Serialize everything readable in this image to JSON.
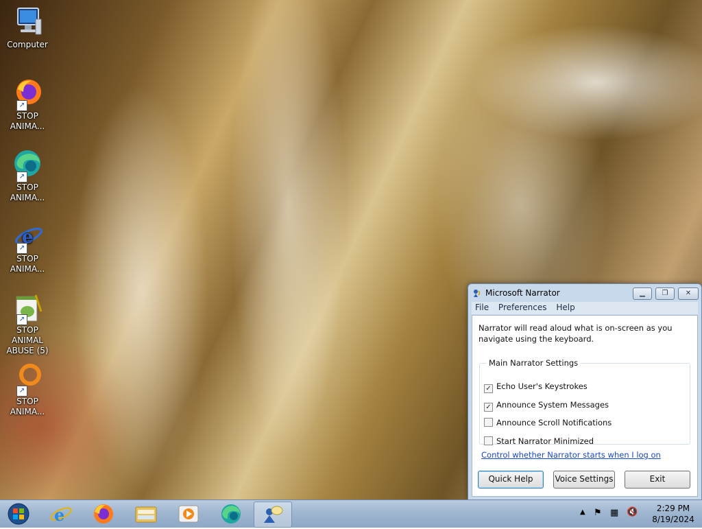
{
  "desktop_icons": [
    {
      "label": "Computer"
    },
    {
      "label": "STOP ANIMA..."
    },
    {
      "label": "STOP ANIMA..."
    },
    {
      "label": "STOP ANIMA..."
    },
    {
      "label": "STOP ANIMAL ABUSE (5)"
    },
    {
      "label": "STOP ANIMA..."
    }
  ],
  "narrator": {
    "title": "Microsoft Narrator",
    "menu": {
      "file": "File",
      "preferences": "Preferences",
      "help": "Help"
    },
    "description": "Narrator will read aloud what is on-screen as you navigate using the keyboard.",
    "settings_group": "Main Narrator Settings",
    "options": [
      {
        "label": "Echo User's Keystrokes",
        "checked": true
      },
      {
        "label": "Announce System Messages",
        "checked": true
      },
      {
        "label": "Announce Scroll Notifications",
        "checked": false
      },
      {
        "label": "Start Narrator Minimized",
        "checked": false
      }
    ],
    "link": "Control whether Narrator starts when I log on",
    "buttons": {
      "quick_help": "Quick Help",
      "voice_settings": "Voice Settings",
      "exit": "Exit"
    }
  },
  "taskbar": {
    "clock_time": "2:29 PM",
    "clock_date": "8/19/2024",
    "pinned": [
      "start-orb",
      "internet-explorer",
      "firefox",
      "windows-explorer",
      "media-player",
      "browser",
      "narrator"
    ]
  },
  "colors": {
    "accent_link": "#1a47c4",
    "titlebar": "#c9d9ec"
  }
}
